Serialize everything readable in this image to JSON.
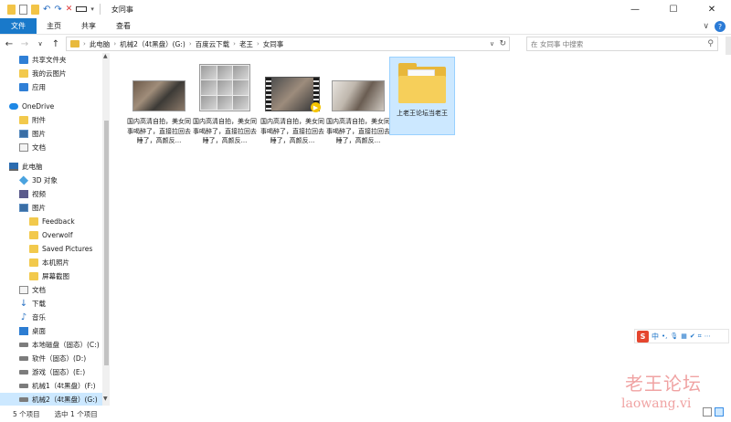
{
  "window": {
    "title": "女同事",
    "controls": {
      "minimize": "—",
      "maximize": "☐",
      "close": "✕"
    }
  },
  "ribbon": {
    "tabs": [
      "文件",
      "主页",
      "共享",
      "查看"
    ],
    "expand": "∨",
    "help": "?"
  },
  "nav": {
    "back": "←",
    "forward": "→",
    "recent": "∨",
    "up": "↑"
  },
  "address": {
    "crumbs": [
      "此电脑",
      "机械2（4t黑盘）(G:)",
      "百度云下载",
      "老王",
      "女同事"
    ],
    "separator": "›",
    "dropdown": "∨",
    "refresh": "↻"
  },
  "search": {
    "placeholder": "在 女同事 中搜索",
    "icon": "⚲"
  },
  "navpane": {
    "items": [
      {
        "label": "共享文件夹",
        "icon": "share-folder-icon",
        "kind": "blue",
        "indent": 1
      },
      {
        "label": "我的云图片",
        "icon": "folder-icon",
        "kind": "folder",
        "indent": 1
      },
      {
        "label": "应用",
        "icon": "apps-icon",
        "kind": "blue",
        "indent": 1
      },
      {
        "label": "OneDrive",
        "icon": "onedrive-icon",
        "kind": "cloud",
        "indent": 0,
        "gap": true
      },
      {
        "label": "附件",
        "icon": "folder-icon",
        "kind": "folder",
        "indent": 1
      },
      {
        "label": "图片",
        "icon": "pictures-icon",
        "kind": "img",
        "indent": 1
      },
      {
        "label": "文档",
        "icon": "documents-icon",
        "kind": "doc",
        "indent": 1
      },
      {
        "label": "此电脑",
        "icon": "this-pc-icon",
        "kind": "pc",
        "indent": 0,
        "gap": true
      },
      {
        "label": "3D 对象",
        "icon": "3d-objects-icon",
        "kind": "cube",
        "indent": 1
      },
      {
        "label": "视频",
        "icon": "videos-icon",
        "kind": "video",
        "indent": 1
      },
      {
        "label": "图片",
        "icon": "pictures-icon",
        "kind": "img",
        "indent": 1
      },
      {
        "label": "Feedback",
        "icon": "folder-icon",
        "kind": "folder",
        "indent": 2
      },
      {
        "label": "Overwolf",
        "icon": "folder-icon",
        "kind": "folder",
        "indent": 2
      },
      {
        "label": "Saved Pictures",
        "icon": "folder-icon",
        "kind": "folder",
        "indent": 2
      },
      {
        "label": "本机照片",
        "icon": "folder-icon",
        "kind": "folder",
        "indent": 2
      },
      {
        "label": "屏幕截图",
        "icon": "folder-icon",
        "kind": "folder",
        "indent": 2
      },
      {
        "label": "文档",
        "icon": "documents-icon",
        "kind": "doc",
        "indent": 1
      },
      {
        "label": "下载",
        "icon": "downloads-icon",
        "kind": "dl",
        "indent": 1
      },
      {
        "label": "音乐",
        "icon": "music-icon",
        "kind": "music",
        "indent": 1
      },
      {
        "label": "桌面",
        "icon": "desktop-icon",
        "kind": "desk",
        "indent": 1
      },
      {
        "label": "本地磁盘（固态）(C:)",
        "icon": "drive-icon",
        "kind": "drive",
        "indent": 1
      },
      {
        "label": "软件（固态）(D:)",
        "icon": "drive-icon",
        "kind": "drive",
        "indent": 1
      },
      {
        "label": "游戏（固态）(E:)",
        "icon": "drive-icon",
        "kind": "drive",
        "indent": 1
      },
      {
        "label": "机械1（4t黑盘）(F:)",
        "icon": "drive-icon",
        "kind": "drive",
        "indent": 1
      },
      {
        "label": "机械2（4t黑盘）(G:)",
        "icon": "drive-icon",
        "kind": "drive",
        "indent": 1,
        "selected": true
      }
    ]
  },
  "files": [
    {
      "label": "国内高清自拍，美女同事喝醉了，直接拉回去睡了，高颜反...",
      "thumb": "photo"
    },
    {
      "label": "国内高清自拍，美女同事喝醉了，直接拉回去睡了，高颜反...",
      "thumb": "collage"
    },
    {
      "label": "国内高清自拍，美女同事喝醉了，直接拉回去睡了，高颜反...",
      "thumb": "film"
    },
    {
      "label": "国内高清自拍，美女同事喝醉了，直接拉回去睡了，高颜反...",
      "thumb": "photo2"
    },
    {
      "label": "上老王论坛当老王",
      "thumb": "folder",
      "selected": true
    }
  ],
  "status": {
    "count": "5 个项目",
    "selection": "选中 1 个项目"
  },
  "ime": {
    "logo": "S",
    "mode": "中",
    "items": [
      "•,",
      "🎙",
      "▦",
      "✔",
      "⌗",
      "⋯"
    ]
  },
  "watermark": {
    "cn": "老王论坛",
    "en": "laowang.vi"
  }
}
